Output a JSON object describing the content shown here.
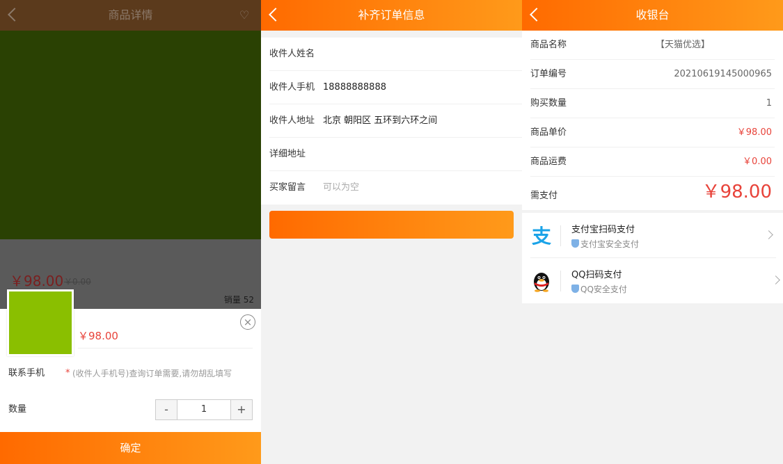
{
  "panel1": {
    "header": {
      "title": "商品详情"
    },
    "dim": {
      "price": "￥98.00",
      "original_price": "￥0.00",
      "sales": "销量 52"
    },
    "sheet": {
      "price": "￥98.00",
      "contact_label": "联系手机",
      "contact_required": "*",
      "contact_placeholder": "(收件人手机号)查询订单需要,请勿胡乱填写",
      "quantity_label": "数量",
      "minus": "-",
      "quantity": "1",
      "plus": "+",
      "confirm": "确定"
    },
    "colors": {
      "thumb": "#8abf00",
      "hero": "#2a4103"
    }
  },
  "panel2": {
    "header": {
      "title": "补齐订单信息"
    },
    "form": [
      {
        "label": "收件人姓名",
        "value": ""
      },
      {
        "label": "收件人手机",
        "value": "18888888888"
      },
      {
        "label": "收件人地址",
        "value": "北京 朝阳区 五环到六环之间"
      },
      {
        "label": "详细地址",
        "value": ""
      },
      {
        "label": "买家留言",
        "placeholder": "可以为空"
      }
    ]
  },
  "panel3": {
    "header": {
      "title": "收银台"
    },
    "info": [
      {
        "label": "商品名称",
        "value": "【天猫优选】"
      },
      {
        "label": "订单编号",
        "value": "20210619145000965"
      },
      {
        "label": "购买数量",
        "value": "1"
      },
      {
        "label": "商品单价",
        "value": "￥98.00"
      },
      {
        "label": "商品运费",
        "value": "￥0.00"
      },
      {
        "label": "需支付",
        "value": "￥98.00"
      }
    ],
    "payments": [
      {
        "title": "支付宝扫码支付",
        "subtitle": "支付宝安全支付",
        "icon": "alipay-icon"
      },
      {
        "title": "QQ扫码支付",
        "subtitle": "QQ安全支付",
        "icon": "qq-penguin-icon"
      }
    ],
    "colors": {
      "accent": "#ff7a00",
      "price": "#e8433a",
      "alipay": "#1aa3e8"
    }
  }
}
